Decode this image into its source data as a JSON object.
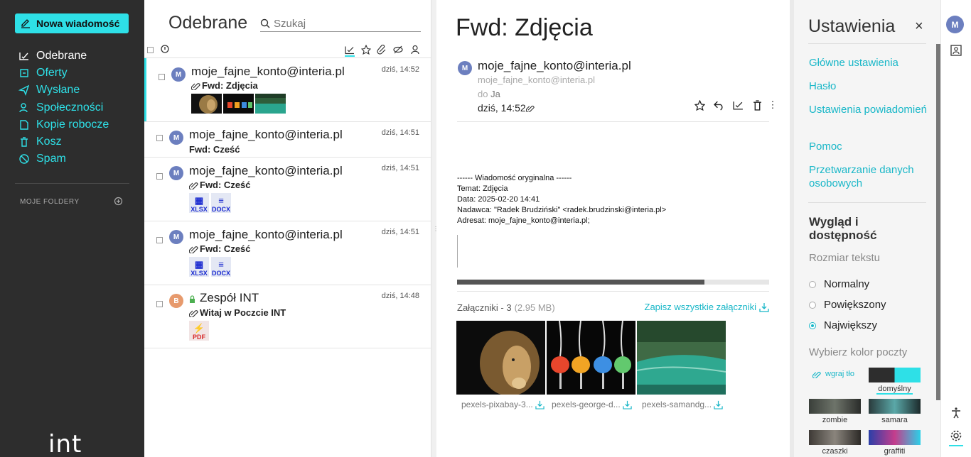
{
  "sidebar": {
    "compose_label": "Nowa wiadomość",
    "items": [
      {
        "label": "Odebrane",
        "icon": "inbox-icon",
        "active": true
      },
      {
        "label": "Oferty",
        "icon": "offers-icon",
        "active": false
      },
      {
        "label": "Wysłane",
        "icon": "send-icon",
        "active": false
      },
      {
        "label": "Społeczności",
        "icon": "people-icon",
        "active": false
      },
      {
        "label": "Kopie robocze",
        "icon": "drafts-icon",
        "active": false
      },
      {
        "label": "Kosz",
        "icon": "trash-icon",
        "active": false
      },
      {
        "label": "Spam",
        "icon": "spam-icon",
        "active": false
      }
    ],
    "folders_label": "MOJE FOLDERY",
    "logo": "int"
  },
  "list": {
    "title": "Odebrane",
    "search_placeholder": "Szukaj",
    "messages": [
      {
        "avatar": "M",
        "from": "moje_fajne_konto@interia.pl",
        "time": "dziś, 14:52",
        "subject": "Fwd: Zdjęcia",
        "attach": true,
        "selected": true
      },
      {
        "avatar": "M",
        "from": "moje_fajne_konto@interia.pl",
        "time": "dziś, 14:51",
        "subject": "Fwd: Cześć",
        "attach": false
      },
      {
        "avatar": "M",
        "from": "moje_fajne_konto@interia.pl",
        "time": "dziś, 14:51",
        "subject": "Fwd: Cześć",
        "attach": true,
        "files": [
          "XLSX",
          "DOCX"
        ]
      },
      {
        "avatar": "M",
        "from": "moje_fajne_konto@interia.pl",
        "time": "dziś, 14:51",
        "subject": "Fwd: Cześć",
        "attach": true,
        "files": [
          "XLSX",
          "DOCX"
        ]
      },
      {
        "avatar": "B",
        "from": "Zespół INT",
        "time": "dziś, 14:48",
        "subject": "Witaj w Poczcie INT",
        "attach": true,
        "files": [
          "PDF"
        ],
        "secure": true
      }
    ]
  },
  "view": {
    "title": "Fwd: Zdjęcia",
    "avatar": "M",
    "from": "moje_fajne_konto@interia.pl",
    "address": "moje_fajne_konto@interia.pl",
    "to_prefix": "do",
    "to": "Ja",
    "date": "dziś, 14:52",
    "body": [
      "------ Wiadomość oryginalna ------",
      "Temat: Zdjęcia",
      "Data: 2025-02-20 14:41",
      "Nadawca: \"Radek Brudziński\" <radek.brudzinski@interia.pl>",
      "Adresat: moje_fajne_konto@interia.pl;"
    ],
    "attachments_label": "Załączniki - 3",
    "attachments_size": "(2.95 MB)",
    "save_all": "Zapisz wszystkie załączniki",
    "attachments": [
      {
        "name": "pexels-pixabay-3..."
      },
      {
        "name": "pexels-george-d..."
      },
      {
        "name": "pexels-samandg..."
      }
    ]
  },
  "settings": {
    "title": "Ustawienia",
    "close": "×",
    "links": [
      "Główne ustawienia",
      "Hasło",
      "Ustawienia powiadomień",
      "Pomoc",
      "Przetwarzanie danych osobowych"
    ],
    "appearance_title": "Wygląd i dostępność",
    "text_size_label": "Rozmiar tekstu",
    "sizes": [
      {
        "label": "Normalny",
        "checked": false
      },
      {
        "label": "Powiększony",
        "checked": false
      },
      {
        "label": "Największy",
        "checked": true
      }
    ],
    "color_label": "Wybierz kolor poczty",
    "upload_label": "wgraj tło",
    "themes": [
      "domyślny",
      "zombie",
      "samara",
      "czaszki",
      "graffiti"
    ]
  },
  "rail": {
    "avatar": "M"
  },
  "colors": {
    "accent": "#2ee0e7",
    "link": "#19b7c8",
    "sidebar": "#2d2d2d"
  }
}
